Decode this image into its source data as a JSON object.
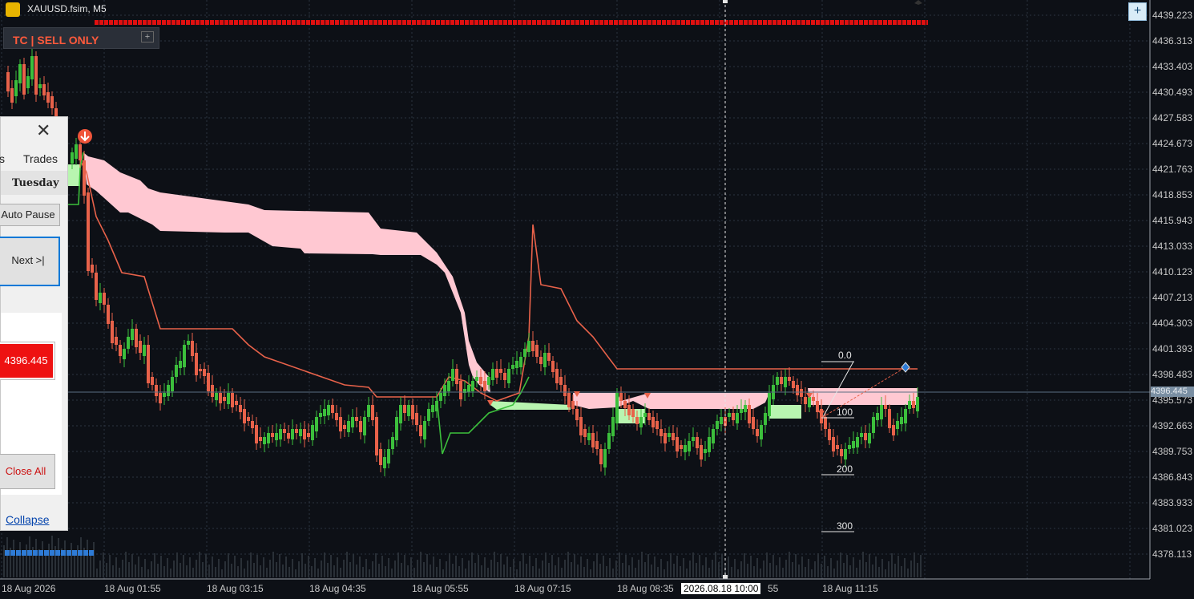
{
  "window": {
    "title": "XAUUSD.fsim, M5"
  },
  "tc_panel": {
    "label": "TC  |  SELL ONLY",
    "plus": "+"
  },
  "corner_button": {
    "label": "+"
  },
  "price_axis": [
    "4439.223",
    "4436.313",
    "4433.403",
    "4430.493",
    "4427.583",
    "4424.673",
    "4421.763",
    "4418.853",
    "4415.943",
    "4413.033",
    "4410.123",
    "4407.213",
    "4404.303",
    "4401.393",
    "4398.483",
    "4395.573",
    "4392.663",
    "4389.753",
    "4386.843",
    "4383.933",
    "4381.023",
    "4378.113"
  ],
  "current_price": "4396.445",
  "time_axis": [
    "18 Aug 2026",
    "18 Aug 01:55",
    "18 Aug 03:15",
    "18 Aug 04:35",
    "18 Aug 05:55",
    "18 Aug 07:15",
    "18 Aug 08:35",
    "55",
    "18 Aug 11:15"
  ],
  "crosshair_time": "2026.08.18 10:00",
  "fib_levels": [
    "0.0",
    "100",
    "200",
    "300"
  ],
  "side_panel": {
    "close_icon": "close-icon",
    "tab_left": "s",
    "tab_trades": "Trades",
    "day": "Tuesday",
    "auto_pause": "Auto Pause",
    "next": "Next  >|",
    "price": "4396.445",
    "close_all": "Close All",
    "collapse": "Collapse"
  },
  "colors": {
    "background": "#0d1016",
    "bear_candle": "#e8624a",
    "bull_candle": "#3cbf3c",
    "cloud_bear": "#ffc8d2",
    "cloud_bull": "#b8f5b0",
    "price_line": "#2e7bd6",
    "red_bar": "#e01010"
  }
}
